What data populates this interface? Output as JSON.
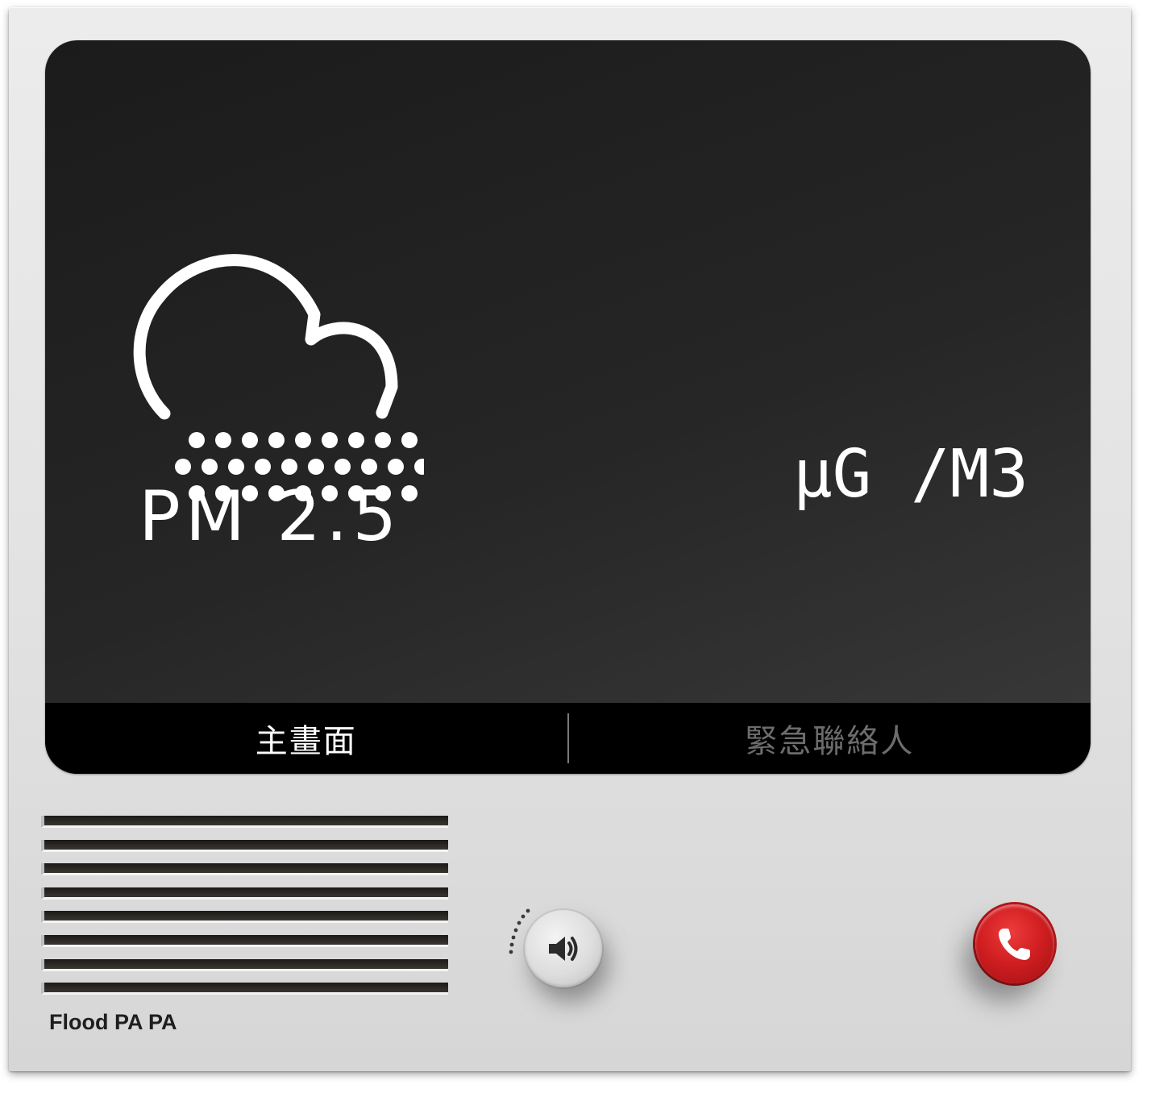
{
  "screen": {
    "measurement_label": "PM 2.5",
    "unit_label": "μG /M3",
    "icon": "cloud-particulate-icon"
  },
  "tabs": [
    {
      "label": "主畫面",
      "active": true
    },
    {
      "label": "緊急聯絡人",
      "active": false
    }
  ],
  "device": {
    "brand": "Flood PA PA"
  },
  "controls": {
    "volume_icon": "speaker-icon",
    "call_icon": "phone-icon"
  },
  "colors": {
    "screen_bg": "#1f1f1f",
    "tab_active": "#ffffff",
    "tab_inactive": "#6c6c6c",
    "call_red": "#d11f22",
    "body": "#e6e6e6"
  }
}
